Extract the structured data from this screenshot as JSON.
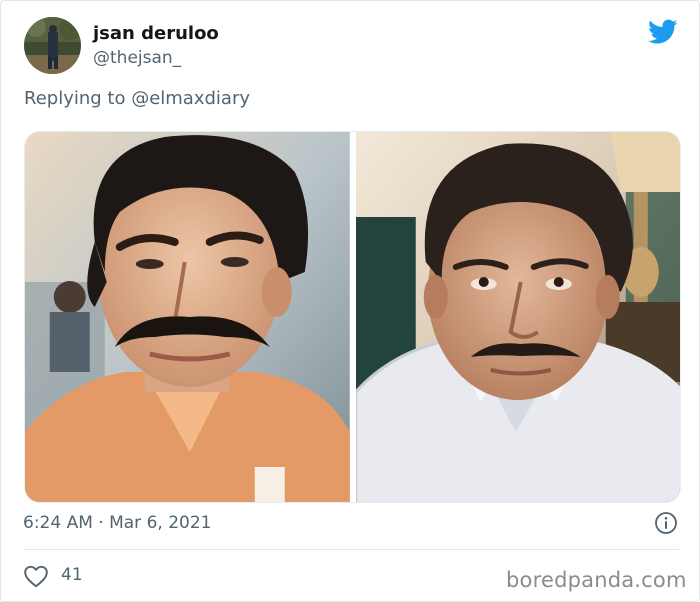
{
  "tweet": {
    "display_name": "jsan deruloo",
    "handle": "@thejsan_",
    "reply_context": "Replying to @elmaxdiary",
    "timestamp": "6:24 AM · Mar 6, 2021",
    "like_count": "41",
    "images": [
      {
        "alt": "photo-left"
      },
      {
        "alt": "photo-right"
      }
    ]
  },
  "watermark": "boredpanda.com",
  "colors": {
    "twitter_blue": "#1d9bf0",
    "muted_text": "#536471",
    "divider": "#e1e8ed"
  },
  "icons": [
    "twitter-bird-icon",
    "info-icon",
    "heart-icon"
  ]
}
